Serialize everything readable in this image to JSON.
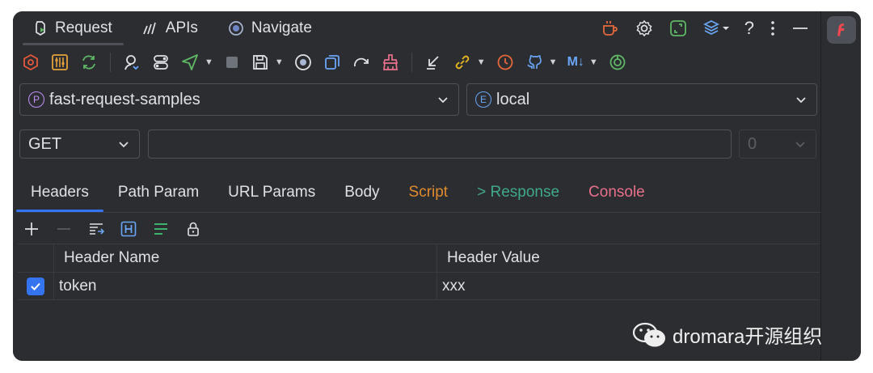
{
  "top_tabs": [
    {
      "label": "Request",
      "icon": "request-icon"
    },
    {
      "label": "APIs",
      "icon": "apis-icon"
    },
    {
      "label": "Navigate",
      "icon": "navigate-icon"
    }
  ],
  "top_right_icons": [
    "coffee-icon",
    "gear-icon",
    "expand-icon",
    "layers-icon",
    "help-icon",
    "more-icon",
    "minimize-icon"
  ],
  "toolbar_icons": [
    "hexagon-icon",
    "config-icon",
    "sync-icon",
    "user-search-icon",
    "toggle-icon",
    "send-icon",
    "stop-icon",
    "save-icon",
    "target-icon",
    "copy-icon",
    "redo-icon",
    "clean-icon",
    "import-icon",
    "link-icon",
    "history-icon",
    "github-icon",
    "markdown-icon",
    "power-icon"
  ],
  "project": {
    "badge": "P",
    "name": "fast-request-samples"
  },
  "environment": {
    "badge": "E",
    "name": "local"
  },
  "method": {
    "value": "GET"
  },
  "url": {
    "value": ""
  },
  "count_select": {
    "value": "0"
  },
  "section_tabs": [
    {
      "label": "Headers",
      "color": "#dfe1e5"
    },
    {
      "label": "Path Param",
      "color": "#dfe1e5"
    },
    {
      "label": "URL Params",
      "color": "#dfe1e5"
    },
    {
      "label": "Body",
      "color": "#dfe1e5"
    },
    {
      "label": "Script",
      "color": "#e08b2e"
    },
    {
      "label": "> Response",
      "color": "#3fa98c"
    },
    {
      "label": "Console",
      "color": "#e8708a"
    }
  ],
  "table_toolbar": [
    "add-icon",
    "remove-icon",
    "bulk-edit-icon",
    "header-icon",
    "list-icon",
    "lock-icon"
  ],
  "headers_table": {
    "columns": [
      "Header Name",
      "Header Value"
    ],
    "rows": [
      {
        "checked": true,
        "name": "token",
        "value": "xxx"
      }
    ]
  },
  "watermark": {
    "text": "dromara开源组织"
  },
  "colors": {
    "accent": "#3574f0",
    "background": "#2b2d30"
  }
}
